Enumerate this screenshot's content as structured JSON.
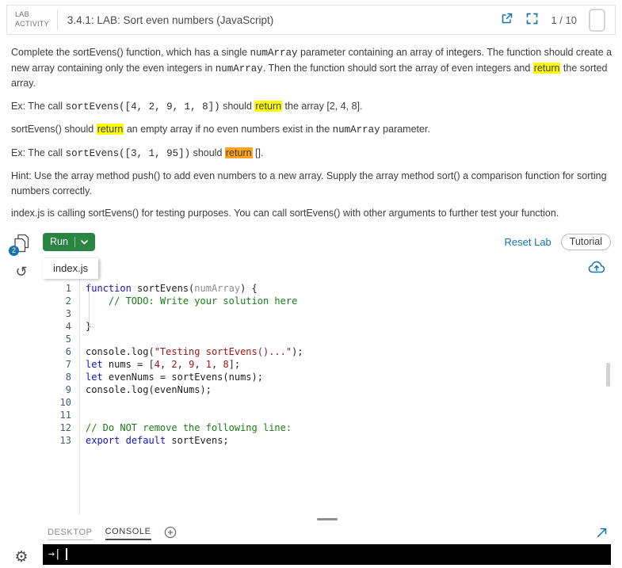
{
  "header": {
    "activity_label_line1": "LAB",
    "activity_label_line2": "ACTIVITY",
    "title": "3.4.1: LAB: Sort even numbers (JavaScript)",
    "progress": "1 / 10"
  },
  "instructions": {
    "paragraphs": [
      {
        "segments": [
          {
            "t": "Complete the sortEvens() function, which has a single ",
            "s": "p"
          },
          {
            "t": "numArray",
            "s": "code"
          },
          {
            "t": " parameter containing an array of integers. The function should create a new array containing only the even integers in ",
            "s": "p"
          },
          {
            "t": "numArray",
            "s": "code"
          },
          {
            "t": ". Then the function should sort the array of even integers and ",
            "s": "p"
          },
          {
            "t": "return",
            "s": "hly"
          },
          {
            "t": " the sorted array.",
            "s": "p"
          }
        ]
      },
      {
        "segments": [
          {
            "t": "Ex: The call ",
            "s": "p"
          },
          {
            "t": "sortEvens([4, 2, 9, 1, 8])",
            "s": "code"
          },
          {
            "t": " should ",
            "s": "p"
          },
          {
            "t": "return",
            "s": "hly"
          },
          {
            "t": " the array [2, 4, 8].",
            "s": "p"
          }
        ]
      },
      {
        "segments": [
          {
            "t": "sortEvens() should ",
            "s": "p"
          },
          {
            "t": "return",
            "s": "hly"
          },
          {
            "t": " an empty array if no even numbers exist in the ",
            "s": "p"
          },
          {
            "t": "numArray",
            "s": "code"
          },
          {
            "t": " parameter.",
            "s": "p"
          }
        ]
      },
      {
        "segments": [
          {
            "t": "Ex: The call ",
            "s": "p"
          },
          {
            "t": "sortEvens([3, 1, 95])",
            "s": "code"
          },
          {
            "t": " should ",
            "s": "p"
          },
          {
            "t": "return",
            "s": "hlo"
          },
          {
            "t": " [].",
            "s": "p"
          }
        ]
      },
      {
        "segments": [
          {
            "t": "Hint: Use the array method push() to add even numbers to a new array. Supply the array method sort() a comparison function for sorting numbers correctly.",
            "s": "p"
          }
        ]
      },
      {
        "segments": [
          {
            "t": "index.js is calling sortEvens() for testing purposes. You can call sortEvens() with other arguments to further test your function.",
            "s": "p"
          }
        ]
      }
    ]
  },
  "toolbar": {
    "run_label": "Run",
    "reset_label": "Reset Lab",
    "tutorial_label": "Tutorial"
  },
  "left_rail": {
    "files_badge_count": "2",
    "history_icon_glyph": "↺",
    "gear_icon_glyph": "⚙"
  },
  "editor": {
    "tab_label": "index.js",
    "lines": [
      {
        "tokens": [
          {
            "t": "function",
            "k": "kw"
          },
          {
            "t": " sortEvens(",
            "k": "pl"
          },
          {
            "t": "numArray",
            "k": "param"
          },
          {
            "t": ") {",
            "k": "pl"
          }
        ]
      },
      {
        "tokens": [
          {
            "t": "    ",
            "k": "pl"
          },
          {
            "t": "// TODO: Write your solution here",
            "k": "cm"
          }
        ]
      },
      {
        "tokens": []
      },
      {
        "tokens": [
          {
            "t": "}",
            "k": "pl"
          }
        ]
      },
      {
        "tokens": []
      },
      {
        "tokens": [
          {
            "t": "console.log(",
            "k": "pl"
          },
          {
            "t": "\"Testing sortEvens()...\"",
            "k": "str"
          },
          {
            "t": ");",
            "k": "pl"
          }
        ]
      },
      {
        "tokens": [
          {
            "t": "let",
            "k": "kw"
          },
          {
            "t": " nums = [",
            "k": "pl"
          },
          {
            "t": "4",
            "k": "num"
          },
          {
            "t": ", ",
            "k": "pl"
          },
          {
            "t": "2",
            "k": "num"
          },
          {
            "t": ", ",
            "k": "pl"
          },
          {
            "t": "9",
            "k": "num"
          },
          {
            "t": ", ",
            "k": "pl"
          },
          {
            "t": "1",
            "k": "num"
          },
          {
            "t": ", ",
            "k": "pl"
          },
          {
            "t": "8",
            "k": "num"
          },
          {
            "t": "];",
            "k": "pl"
          }
        ]
      },
      {
        "tokens": [
          {
            "t": "let",
            "k": "kw"
          },
          {
            "t": " evenNums = sortEvens(nums);",
            "k": "pl"
          }
        ]
      },
      {
        "tokens": [
          {
            "t": "console.log(evenNums);",
            "k": "pl"
          }
        ]
      },
      {
        "tokens": []
      },
      {
        "tokens": []
      },
      {
        "tokens": [
          {
            "t": "// Do NOT remove the following line:",
            "k": "cm"
          }
        ]
      },
      {
        "tokens": [
          {
            "t": "export",
            "k": "kw"
          },
          {
            "t": " ",
            "k": "pl"
          },
          {
            "t": "default",
            "k": "kw"
          },
          {
            "t": " sortEvens;",
            "k": "pl"
          }
        ]
      }
    ]
  },
  "bottom": {
    "tabs": [
      {
        "label": "DESKTOP",
        "active": false
      },
      {
        "label": "CONSOLE",
        "active": true
      }
    ]
  },
  "console": {
    "prompt": "→|"
  },
  "colors": {
    "accent_blue": "#1374ad",
    "run_green": "#2a8542",
    "highlight_yellow": "#fcfc00",
    "highlight_orange": "#ffa41c",
    "keyword_blue": "#1212c8",
    "comment_green": "#187d18",
    "string_red": "#a31515"
  }
}
